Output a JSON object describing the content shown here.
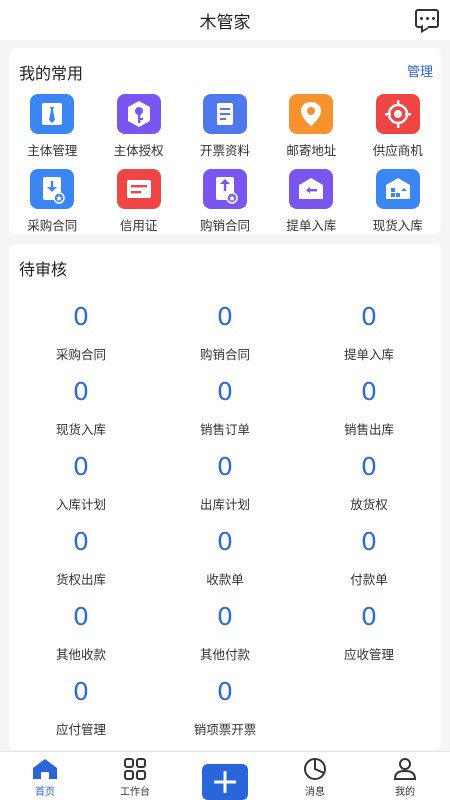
{
  "header": {
    "title": "木管家",
    "more_icon": "chat-dots-icon"
  },
  "favorites": {
    "title": "我的常用",
    "manage_label": "管理",
    "items": [
      {
        "label": "主体管理",
        "icon": "tie-icon",
        "color": "#3a86f2"
      },
      {
        "label": "主体授权",
        "icon": "key-icon",
        "color": "#7a55f0"
      },
      {
        "label": "开票资料",
        "icon": "document-icon",
        "color": "#4f78ef"
      },
      {
        "label": "邮寄地址",
        "icon": "location-pin-icon",
        "color": "#f7922e"
      },
      {
        "label": "供应商机",
        "icon": "target-icon",
        "color": "#ef4545"
      },
      {
        "label": "采购合同",
        "icon": "download-contract-icon",
        "color": "#3a86f2"
      },
      {
        "label": "信用证",
        "icon": "card-icon",
        "color": "#ef4545"
      },
      {
        "label": "购销合同",
        "icon": "upload-contract-icon",
        "color": "#7a55f0"
      },
      {
        "label": "提单入库",
        "icon": "warehouse-in-icon",
        "color": "#7a55f0"
      },
      {
        "label": "现货入库",
        "icon": "warehouse-stock-icon",
        "color": "#3a86f2"
      }
    ]
  },
  "pending": {
    "title": "待审核",
    "items": [
      {
        "count": "0",
        "label": "采购合同"
      },
      {
        "count": "0",
        "label": "购销合同"
      },
      {
        "count": "0",
        "label": "提单入库"
      },
      {
        "count": "0",
        "label": "现货入库"
      },
      {
        "count": "0",
        "label": "销售订单"
      },
      {
        "count": "0",
        "label": "销售出库"
      },
      {
        "count": "0",
        "label": "入库计划"
      },
      {
        "count": "0",
        "label": "出库计划"
      },
      {
        "count": "0",
        "label": "放货权"
      },
      {
        "count": "0",
        "label": "货权出库"
      },
      {
        "count": "0",
        "label": "收款单"
      },
      {
        "count": "0",
        "label": "付款单"
      },
      {
        "count": "0",
        "label": "其他收款"
      },
      {
        "count": "0",
        "label": "其他付款"
      },
      {
        "count": "0",
        "label": "应收管理"
      },
      {
        "count": "0",
        "label": "应付管理"
      },
      {
        "count": "0",
        "label": "销项票开票"
      }
    ]
  },
  "tabbar": {
    "home": "首页",
    "workbench": "工作台",
    "add_icon": "plus-icon",
    "messages": "消息",
    "mine": "我的"
  },
  "colors": {
    "accent": "#2a66d9",
    "count": "#2f6ad9"
  }
}
